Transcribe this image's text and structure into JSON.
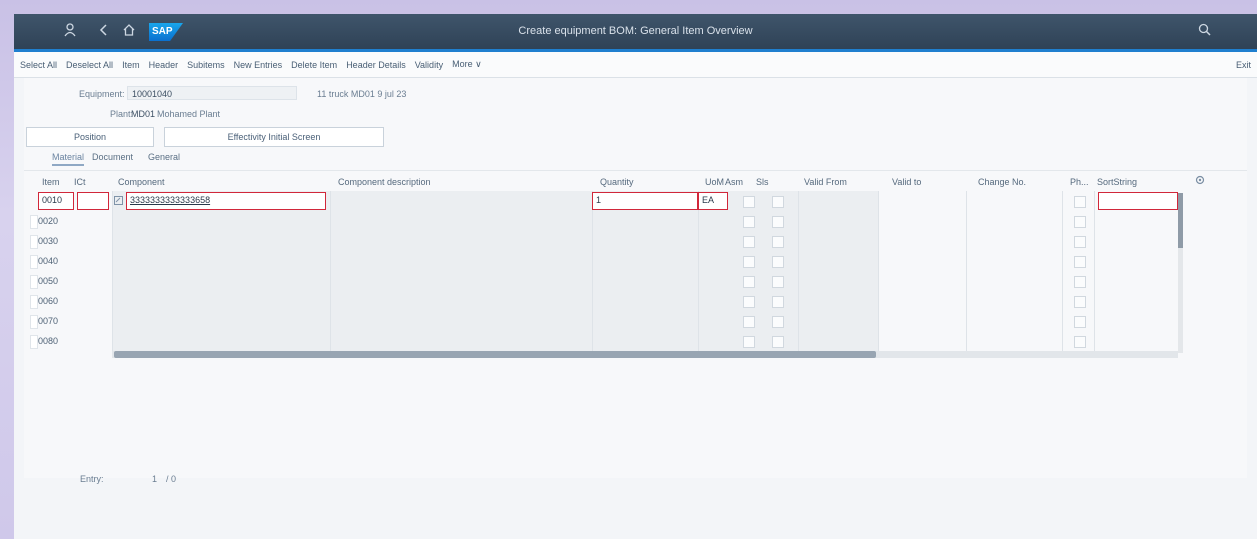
{
  "shell": {
    "title": "Create equipment BOM: General Item Overview",
    "sap_logo_text": "SAP",
    "icons": [
      "user-icon",
      "back-icon",
      "home-icon",
      "search-icon"
    ]
  },
  "toolbar": {
    "items": [
      "Select All",
      "Deselect All",
      "Item",
      "Header",
      "Subitems",
      "New Entries",
      "Delete Item",
      "Header Details",
      "Validity",
      "More ∨"
    ],
    "exit_label": "Exit"
  },
  "header": {
    "equipment_label": "Equipment:",
    "equipment_value": "10001040",
    "equipment_desc": "11 truck MD01 9 jul 23",
    "plant_label": "Plant:",
    "plant_value": "MD01",
    "plant_desc": "Mohamed Plant"
  },
  "buttons": {
    "position": "Position",
    "effectivity": "Effectivity Initial Screen"
  },
  "tabs": [
    "Material",
    "Document",
    "General"
  ],
  "table": {
    "columns": [
      "Item",
      "ICt",
      "Component",
      "Component description",
      "Quantity",
      "UoM",
      "Asm",
      "Sls",
      "Valid From",
      "Valid to",
      "Change No.",
      "Ph...",
      "SortString"
    ],
    "rows": [
      {
        "item": "0010",
        "ict": "",
        "component": "3333333333333658",
        "quantity": "1",
        "uom": "EA"
      },
      {
        "item": "0020"
      },
      {
        "item": "0030"
      },
      {
        "item": "0040"
      },
      {
        "item": "0050"
      },
      {
        "item": "0060"
      },
      {
        "item": "0070"
      },
      {
        "item": "0080"
      }
    ]
  },
  "footer": {
    "entry_label": "Entry:",
    "entry_value": "1",
    "entry_total": "/ 0"
  }
}
